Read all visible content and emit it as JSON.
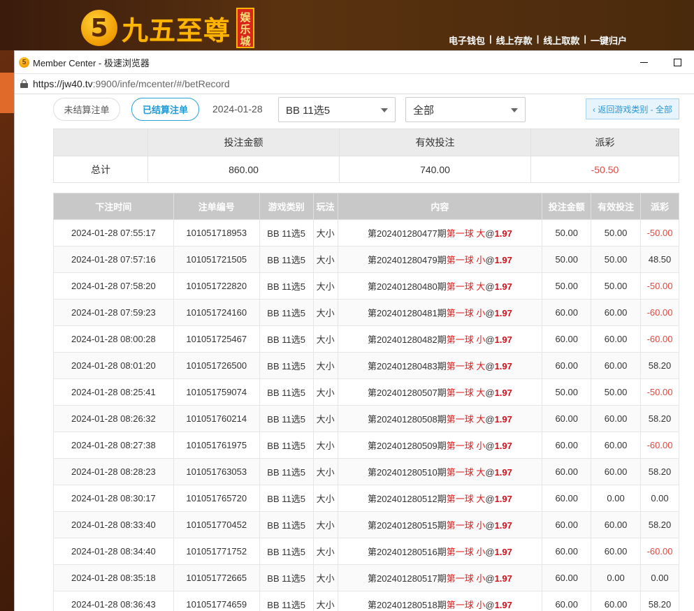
{
  "site": {
    "logo_glyph": "5",
    "logo_text": "九五至尊",
    "logo_badge": [
      "娱",
      "乐",
      "城"
    ],
    "nav": [
      "电子钱包",
      "线上存款",
      "线上取款",
      "一键归户"
    ],
    "nav_separator": "|"
  },
  "window": {
    "title": "Member Center - 极速浏览器",
    "url_host": "https://jw40.tv",
    "url_rest": ":9900/infe/mcenter/#/betRecord"
  },
  "filters": {
    "unsettled_label": "未结算注单",
    "settled_label": "已结算注单",
    "date": "2024-01-28",
    "game_select": "BB 11选5",
    "scope_select": "全部",
    "back_label": "‹ 返回游戏类别 - 全部"
  },
  "summary": {
    "headers": [
      "投注金额",
      "有效投注",
      "派彩"
    ],
    "row_label": "总计",
    "bet_total": "860.00",
    "valid_total": "740.00",
    "payout_total": "-50.50"
  },
  "records": {
    "headers": [
      "下注时间",
      "注单编号",
      "游戏类别",
      "玩法",
      "内容",
      "投注金额",
      "有效投注",
      "派彩"
    ],
    "rows": [
      {
        "time": "2024-01-28 07:55:17",
        "no": "101051718953",
        "type": "BB 11选5",
        "play": "大小",
        "issue": "第202401280477期",
        "pick": "第一球 大",
        "odds": "1.97",
        "bet": "50.00",
        "valid": "50.00",
        "win": "-50.00"
      },
      {
        "time": "2024-01-28 07:57:16",
        "no": "101051721505",
        "type": "BB 11选5",
        "play": "大小",
        "issue": "第202401280479期",
        "pick": "第一球 小",
        "odds": "1.97",
        "bet": "50.00",
        "valid": "50.00",
        "win": "48.50"
      },
      {
        "time": "2024-01-28 07:58:20",
        "no": "101051722820",
        "type": "BB 11选5",
        "play": "大小",
        "issue": "第202401280480期",
        "pick": "第一球 大",
        "odds": "1.97",
        "bet": "50.00",
        "valid": "50.00",
        "win": "-50.00"
      },
      {
        "time": "2024-01-28 07:59:23",
        "no": "101051724160",
        "type": "BB 11选5",
        "play": "大小",
        "issue": "第202401280481期",
        "pick": "第一球 小",
        "odds": "1.97",
        "bet": "60.00",
        "valid": "60.00",
        "win": "-60.00"
      },
      {
        "time": "2024-01-28 08:00:28",
        "no": "101051725467",
        "type": "BB 11选5",
        "play": "大小",
        "issue": "第202401280482期",
        "pick": "第一球 小",
        "odds": "1.97",
        "bet": "60.00",
        "valid": "60.00",
        "win": "-60.00"
      },
      {
        "time": "2024-01-28 08:01:20",
        "no": "101051726500",
        "type": "BB 11选5",
        "play": "大小",
        "issue": "第202401280483期",
        "pick": "第一球 大",
        "odds": "1.97",
        "bet": "60.00",
        "valid": "60.00",
        "win": "58.20"
      },
      {
        "time": "2024-01-28 08:25:41",
        "no": "101051759074",
        "type": "BB 11选5",
        "play": "大小",
        "issue": "第202401280507期",
        "pick": "第一球 大",
        "odds": "1.97",
        "bet": "50.00",
        "valid": "50.00",
        "win": "-50.00"
      },
      {
        "time": "2024-01-28 08:26:32",
        "no": "101051760214",
        "type": "BB 11选5",
        "play": "大小",
        "issue": "第202401280508期",
        "pick": "第一球 大",
        "odds": "1.97",
        "bet": "60.00",
        "valid": "60.00",
        "win": "58.20"
      },
      {
        "time": "2024-01-28 08:27:38",
        "no": "101051761975",
        "type": "BB 11选5",
        "play": "大小",
        "issue": "第202401280509期",
        "pick": "第一球 小",
        "odds": "1.97",
        "bet": "60.00",
        "valid": "60.00",
        "win": "-60.00"
      },
      {
        "time": "2024-01-28 08:28:23",
        "no": "101051763053",
        "type": "BB 11选5",
        "play": "大小",
        "issue": "第202401280510期",
        "pick": "第一球 大",
        "odds": "1.97",
        "bet": "60.00",
        "valid": "60.00",
        "win": "58.20"
      },
      {
        "time": "2024-01-28 08:30:17",
        "no": "101051765720",
        "type": "BB 11选5",
        "play": "大小",
        "issue": "第202401280512期",
        "pick": "第一球 大",
        "odds": "1.97",
        "bet": "60.00",
        "valid": "0.00",
        "win": "0.00"
      },
      {
        "time": "2024-01-28 08:33:40",
        "no": "101051770452",
        "type": "BB 11选5",
        "play": "大小",
        "issue": "第202401280515期",
        "pick": "第一球 小",
        "odds": "1.97",
        "bet": "60.00",
        "valid": "60.00",
        "win": "58.20"
      },
      {
        "time": "2024-01-28 08:34:40",
        "no": "101051771752",
        "type": "BB 11选5",
        "play": "大小",
        "issue": "第202401280516期",
        "pick": "第一球 小",
        "odds": "1.97",
        "bet": "60.00",
        "valid": "60.00",
        "win": "-60.00"
      },
      {
        "time": "2024-01-28 08:35:18",
        "no": "101051772665",
        "type": "BB 11选5",
        "play": "大小",
        "issue": "第202401280517期",
        "pick": "第一球 小",
        "odds": "1.97",
        "bet": "60.00",
        "valid": "0.00",
        "win": "0.00"
      },
      {
        "time": "2024-01-28 08:36:43",
        "no": "101051774659",
        "type": "BB 11选5",
        "play": "大小",
        "issue": "第202401280518期",
        "pick": "第一球 小",
        "odds": "1.97",
        "bet": "60.00",
        "valid": "60.00",
        "win": "58.20"
      }
    ]
  },
  "colors": {
    "accent_blue": "#1e9ad6",
    "negative_red": "#e0483e",
    "pick_red": "#e01b1b",
    "header_gray": "#c8c8c8"
  }
}
